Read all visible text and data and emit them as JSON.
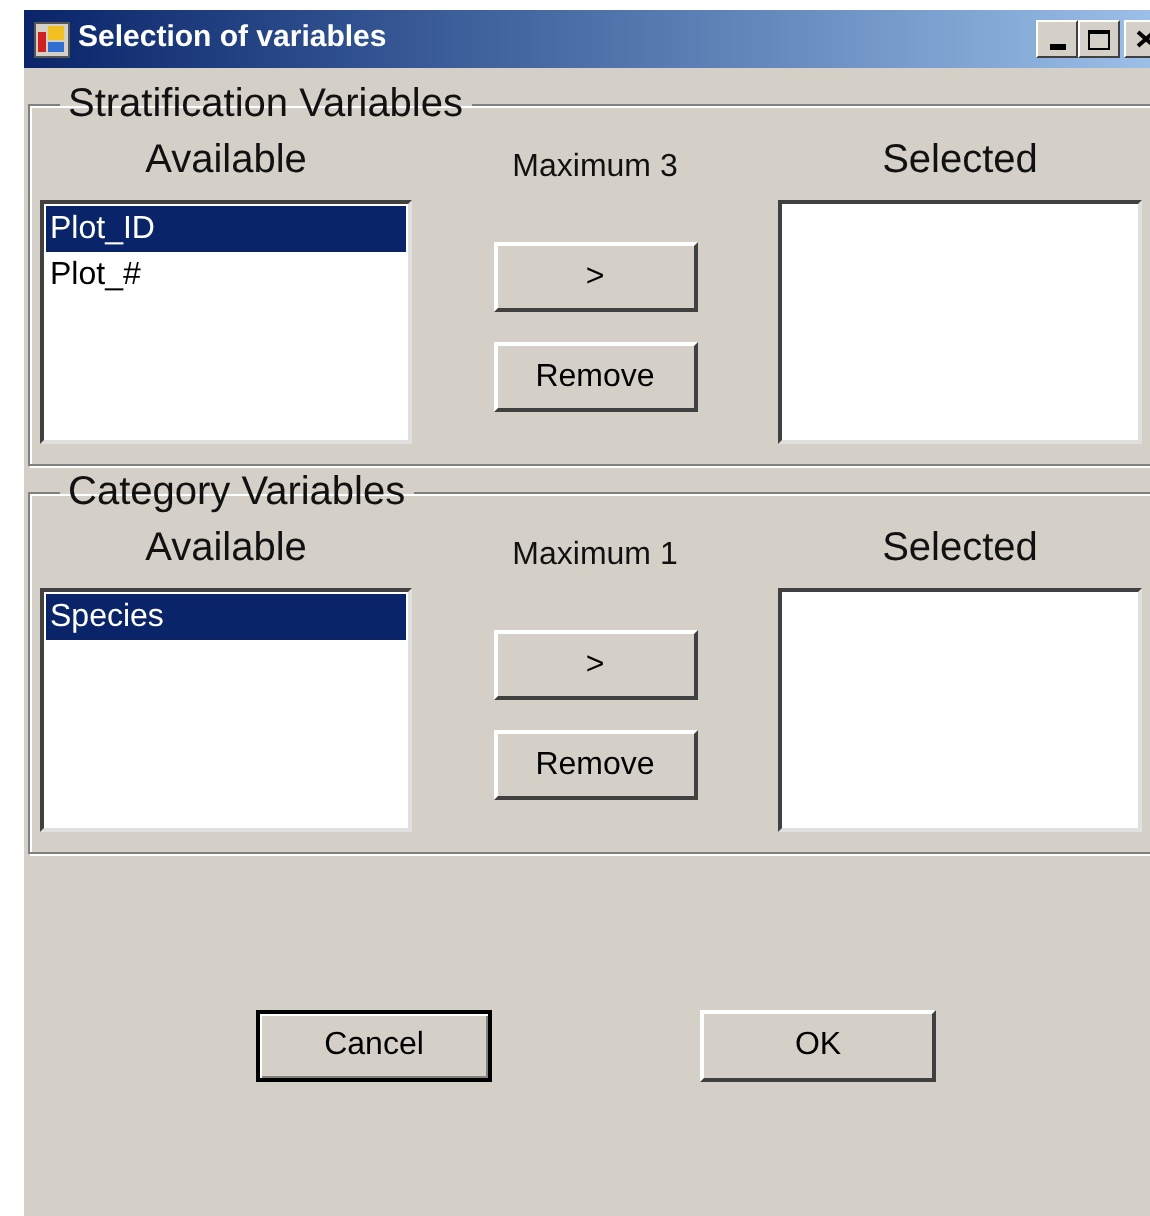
{
  "window": {
    "title": "Selection of variables"
  },
  "groups": [
    {
      "legend": "Stratification Variables",
      "available_label": "Available",
      "maximum_label": "Maximum 3",
      "selected_label": "Selected",
      "available_items": [
        {
          "label": "Plot_ID",
          "selected": true
        },
        {
          "label": "Plot_#",
          "selected": false
        }
      ],
      "add_button": ">",
      "remove_button": "Remove"
    },
    {
      "legend": "Category Variables",
      "available_label": "Available",
      "maximum_label": "Maximum 1",
      "selected_label": "Selected",
      "available_items": [
        {
          "label": "Species",
          "selected": true
        }
      ],
      "add_button": ">",
      "remove_button": "Remove"
    }
  ],
  "buttons": [
    {
      "label": "Cancel",
      "default": true
    },
    {
      "label": "OK",
      "default": false
    }
  ]
}
